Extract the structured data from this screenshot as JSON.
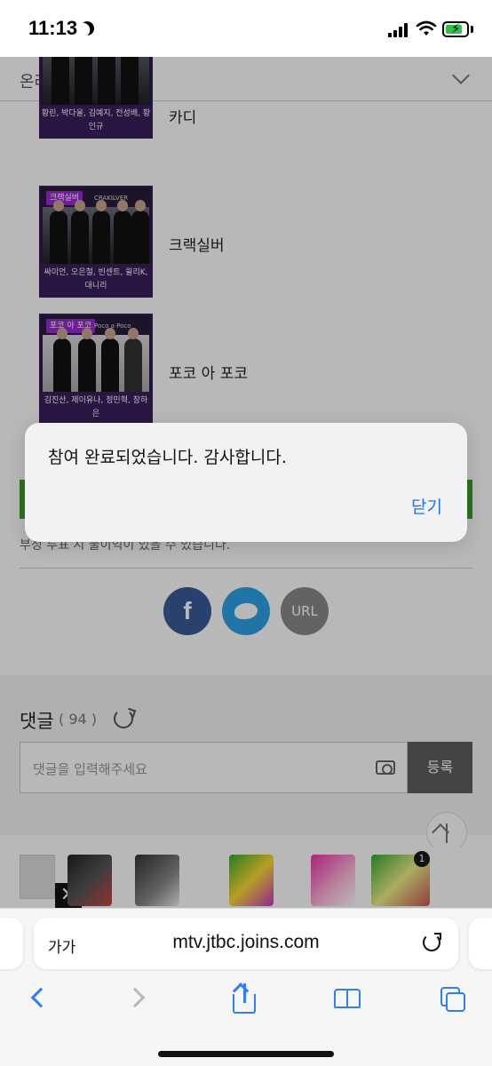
{
  "status_bar": {
    "time": "11:13",
    "icons": [
      "moon-icon",
      "signal-icon",
      "wifi-icon",
      "battery-charging-icon"
    ],
    "battery_color": "#30c04a"
  },
  "page": {
    "section_title": "온라인 사전투표",
    "candidates": [
      {
        "name": "카디",
        "poster_members": "황린, 박다울, 김예지, 전성배, 황인규"
      },
      {
        "name": "크랙실버",
        "poster_tag": "크랙실버",
        "poster_tag_sub": "CRAKILVER",
        "poster_members": "싸이언, 오은철, 빈센트, 윌리K, 대니리"
      },
      {
        "name": "포코 아 포코",
        "poster_tag": "포코 아 포코",
        "poster_tag_sub": "Poco a Poco",
        "poster_members": "김진산, 제이유나, 정민혁, 장하은"
      }
    ],
    "vote_bar_color": "#3f9e2a",
    "notice_text": "부정 투표 시 불이익이 있을 수 있습니다.",
    "share": {
      "facebook_label": "f",
      "url_label": "URL"
    },
    "comments": {
      "title": "댓글",
      "count": "( 94 )",
      "placeholder": "댓글을 입력해주세요",
      "submit_label": "등록"
    },
    "ad": {
      "close_label": "✕",
      "badge": "1"
    }
  },
  "alert": {
    "message": "참여 완료되었습니다. 감사합니다.",
    "close_label": "닫기",
    "accent": "#1a73e8"
  },
  "browser": {
    "text_size_label": "가가",
    "url": "mtv.jtbc.joins.com",
    "accent": "#2f7ef6"
  }
}
